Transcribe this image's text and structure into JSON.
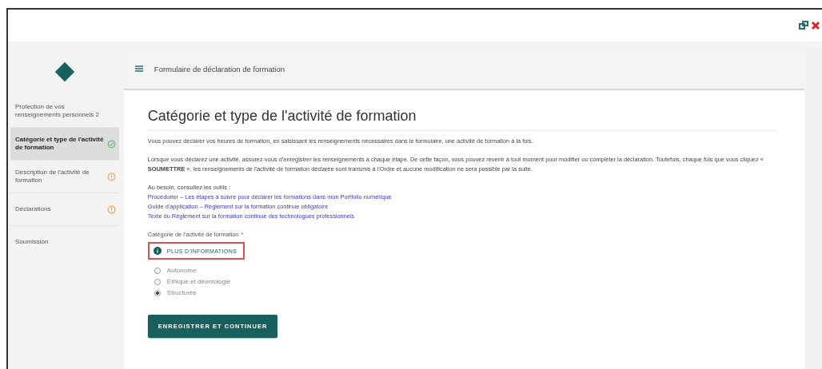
{
  "header": {
    "title": "Formulaire de déclaration de formation"
  },
  "steps": [
    {
      "label": "Protection de vos renseignements personnels 2",
      "kind": "plain",
      "selected": false
    },
    {
      "label": "Catégorie et type de l'activité de formation",
      "kind": "complete",
      "selected": true
    },
    {
      "label": "Description de l'activité de formation",
      "kind": "warning",
      "selected": false
    },
    {
      "label": "Déclarations",
      "kind": "warning",
      "selected": false
    },
    {
      "label": "Soumission",
      "kind": "plain",
      "selected": false
    }
  ],
  "page": {
    "title": "Catégorie et type de l'activité de formation",
    "paragraphs": [
      "Vous pouvez déclarer vos heures de formation, en saisissant les renseignements nécessaires dans le formulaire, une activité de formation à la fois.",
      "Lorsque vous déclarez une activité, assurez-vous d'enregistrer les renseignements à chaque étape. De cette façon, vous pouvez revenir à tout moment pour modifier ou compléter la déclaration. Toutefois, chaque fois que vous cliquez « **SOUMETTRE** », les renseignements de l'activité de formation déclarée sont transmis à l'Ordre et aucune modification ne sera possible par la suite."
    ],
    "tools_intro": "Au besoin, consultez les outils :",
    "links": [
      "Procédurier – Les étapes à suivre pour déclarer les formations dans mon Portfolio numérique",
      "Guide d'application – Règlement sur la formation continue obligatoire",
      "Texte du Règlement sur la formation continue des technologues professionnels"
    ],
    "field_label": "Catégorie de l'activité de formation",
    "required_mark": "*",
    "info_button": "PLUS D'INFORMATIONS",
    "options": [
      {
        "label": "Autonome",
        "selected": false
      },
      {
        "label": "Éthique et déontologie",
        "selected": false
      },
      {
        "label": "Structurée",
        "selected": true
      }
    ],
    "submit": "ENREGISTRER ET CONTINUER"
  }
}
